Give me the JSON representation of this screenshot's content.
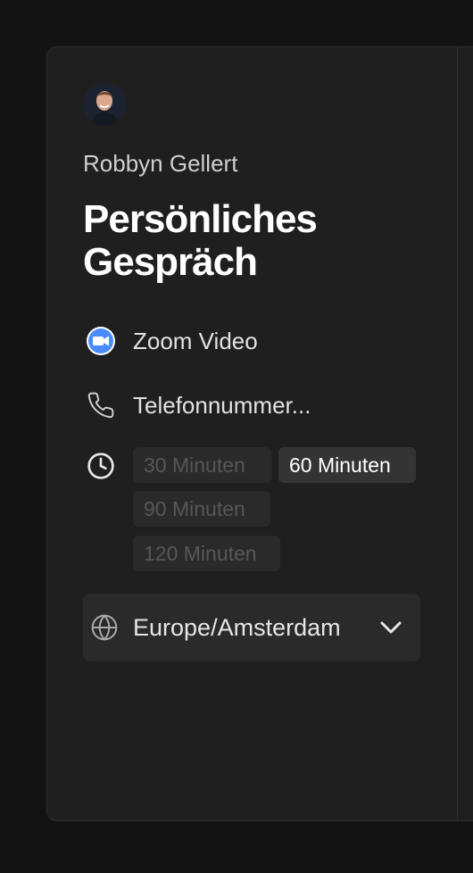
{
  "host": {
    "name": "Robbyn Gellert"
  },
  "event": {
    "title": "Persönliches Gespräch"
  },
  "locations": [
    {
      "icon": "zoom-video-icon",
      "label": "Zoom Video"
    },
    {
      "icon": "phone-icon",
      "label": "Telefonnummer..."
    }
  ],
  "durations": {
    "icon": "clock-icon",
    "options": [
      "30 Minuten",
      "60 Minuten",
      "90 Minuten",
      "120 Minuten"
    ],
    "selected": "60 Minuten"
  },
  "timezone": {
    "icon": "globe-icon",
    "value": "Europe/Amsterdam",
    "dropdown_icon": "chevron-down-icon"
  },
  "colors": {
    "background": "#131313",
    "card": "#1f1f1f",
    "pill": "#2a2a2a",
    "pill_active": "#343434",
    "zoom_blue": "#4a8cff"
  }
}
